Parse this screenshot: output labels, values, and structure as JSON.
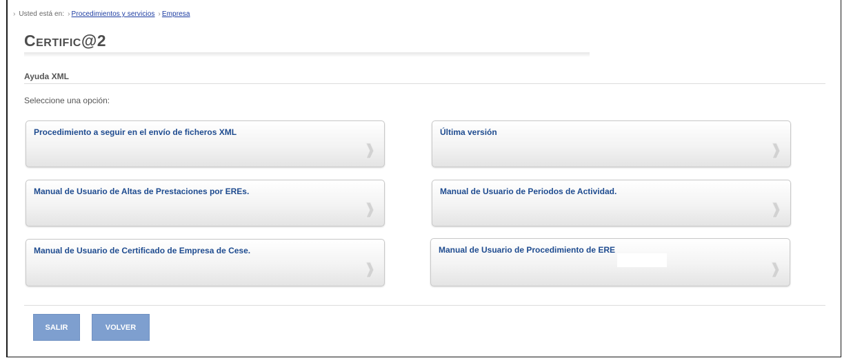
{
  "breadcrumb": {
    "prefix": "Usted está en:",
    "links": [
      "Procedimientos y servicios",
      "Empresa"
    ]
  },
  "page": {
    "title": "Certific@2",
    "section": "Ayuda XML",
    "prompt": "Seleccione una opción:"
  },
  "options": [
    "Procedimiento a seguir en el envío de ficheros XML",
    "Última versión",
    "Manual de Usuario de Altas de Prestaciones por EREs.",
    "Manual de Usuario de Periodos de Actividad.",
    "Manual de Usuario de Certificado de Empresa de Cese.",
    "Manual de Usuario de Procedimiento de ERE"
  ],
  "buttons": {
    "exit": "SALIR",
    "back": "VOLVER"
  },
  "colors": {
    "link": "#1a3aa0",
    "option_text": "#1e4b8f",
    "button_bg": "#7e9fcf"
  },
  "icons": {
    "option_arrow": "chevron-right-icon"
  }
}
